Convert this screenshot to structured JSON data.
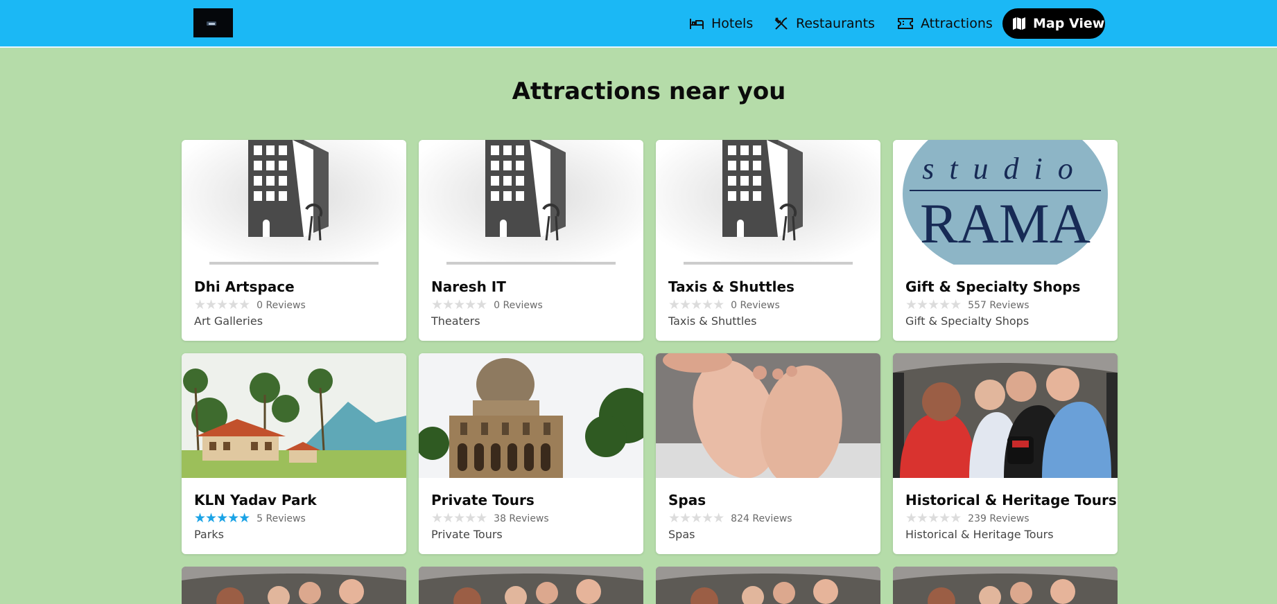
{
  "header": {
    "nav": [
      {
        "label": "Hotels",
        "icon": "bed-icon"
      },
      {
        "label": "Restaurants",
        "icon": "fork-knife-icon"
      },
      {
        "label": "Attractions",
        "icon": "ticket-icon"
      }
    ],
    "map_view": {
      "label": "Map View",
      "icon": "map-icon"
    }
  },
  "page": {
    "heading": "Attractions near you"
  },
  "cards": [
    {
      "title": "Dhi Artspace",
      "rating": 0,
      "reviews": "0 Reviews",
      "category": "Art Galleries",
      "image": "hotel-building-placeholder"
    },
    {
      "title": "Naresh IT",
      "rating": 0,
      "reviews": "0 Reviews",
      "category": "Theaters",
      "image": "hotel-building-placeholder"
    },
    {
      "title": "Taxis & Shuttles",
      "rating": 0,
      "reviews": "0 Reviews",
      "category": "Taxis & Shuttles",
      "image": "hotel-building-placeholder"
    },
    {
      "title": "Gift & Specialty Shops",
      "rating": 0,
      "reviews": "557 Reviews",
      "category": "Gift & Specialty Shops",
      "image": "studio-rama-logo",
      "logo_line1": "studio",
      "logo_line2": "RAMA"
    },
    {
      "title": "KLN Yadav Park",
      "rating": 5,
      "reviews": "5 Reviews",
      "category": "Parks",
      "image": "painted-village-scene"
    },
    {
      "title": "Private Tours",
      "rating": 0,
      "reviews": "38 Reviews",
      "category": "Private Tours",
      "image": "domed-tomb-photo"
    },
    {
      "title": "Spas",
      "rating": 0,
      "reviews": "824 Reviews",
      "category": "Spas",
      "image": "foot-massage-photo"
    },
    {
      "title": "Historical & Heritage Tours",
      "rating": 0,
      "reviews": "239 Reviews",
      "category": "Historical & Heritage Tours",
      "image": "tuk-tuk-group-photo"
    }
  ],
  "colors": {
    "header": "#1bb8f5",
    "background": "#b5dca9",
    "star_filled": "#1ba3e6",
    "star_empty": "#dcdcdc"
  }
}
